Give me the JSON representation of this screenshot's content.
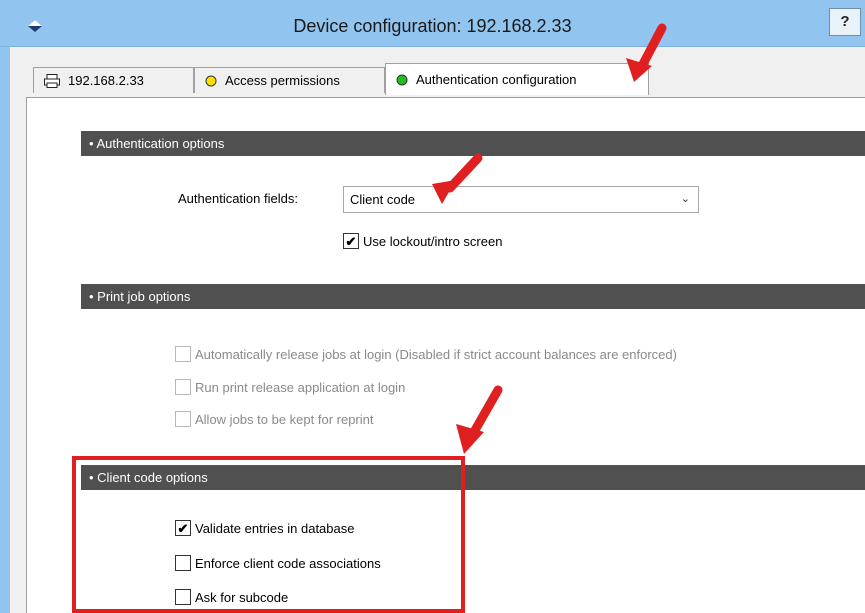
{
  "window": {
    "title": "Device configuration: 192.168.2.33",
    "help_label": "?"
  },
  "tabs": [
    {
      "label": "192.168.2.33",
      "icon": "printer-icon"
    },
    {
      "label": "Access permissions",
      "icon": "yellow-dot-icon"
    },
    {
      "label": "Authentication configuration",
      "icon": "green-dot-icon",
      "active": true
    }
  ],
  "sections": {
    "auth_options": "• Authentication options",
    "print_job_options": "• Print job options",
    "client_code_options": "• Client code options"
  },
  "auth": {
    "fields_label": "Authentication fields:",
    "fields_value": "Client code",
    "lockout_label": "Use lockout/intro screen",
    "lockout_checked": true
  },
  "print_jobs": {
    "auto_release": "Automatically release jobs at login (Disabled if strict account balances are enforced)",
    "run_release_app": "Run print release application at login",
    "allow_keep": "Allow jobs to be kept for reprint"
  },
  "client_code": {
    "validate": "Validate entries in database",
    "validate_checked": true,
    "enforce": "Enforce client code associations",
    "enforce_checked": false,
    "subcode": "Ask for subcode",
    "subcode_checked": false
  },
  "colors": {
    "titlebar": "#92c4f0",
    "section_header": "#505050",
    "highlight": "#e02020",
    "annotation_arrow": "#e02020"
  }
}
